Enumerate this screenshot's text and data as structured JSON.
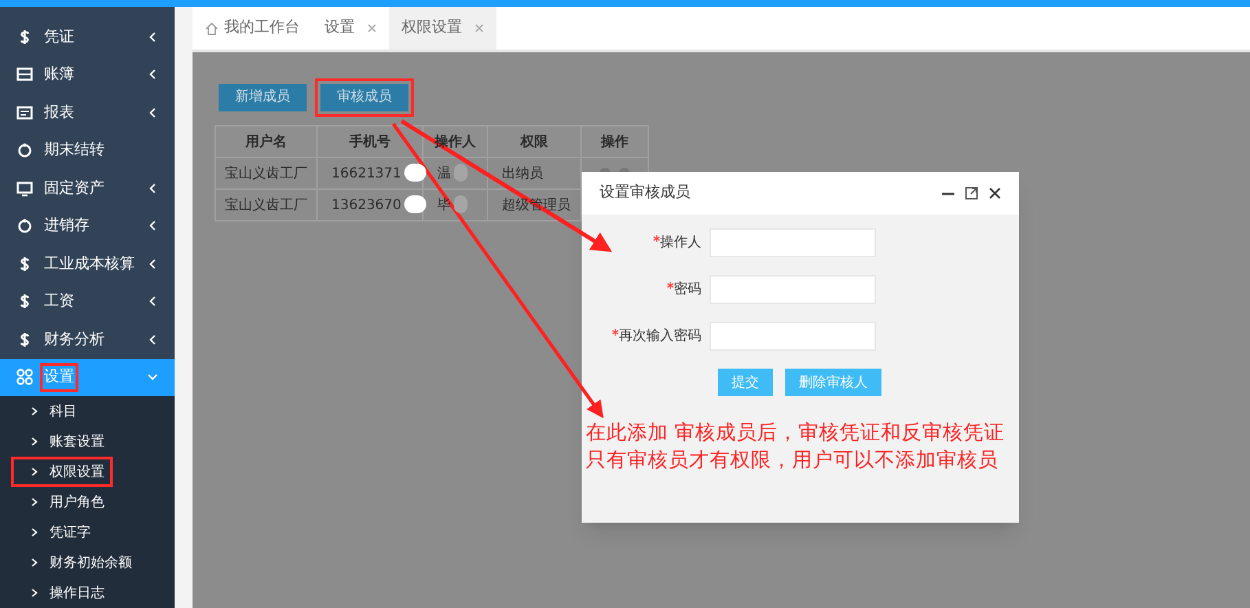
{
  "sidebar": {
    "items": [
      {
        "label": "凭证",
        "kind": "dollar",
        "has_arrow": true,
        "selected": false,
        "expanded": false,
        "highlighted": false
      },
      {
        "label": "账簿",
        "kind": "book",
        "has_arrow": true,
        "selected": false,
        "expanded": false,
        "highlighted": false
      },
      {
        "label": "报表",
        "kind": "report",
        "has_arrow": true,
        "selected": false,
        "expanded": false,
        "highlighted": false
      },
      {
        "label": "期末结转",
        "kind": "cycle",
        "has_arrow": false,
        "selected": false,
        "expanded": false,
        "highlighted": false
      },
      {
        "label": "固定资产",
        "kind": "monitor",
        "has_arrow": true,
        "selected": false,
        "expanded": false,
        "highlighted": false
      },
      {
        "label": "进销存",
        "kind": "cycle",
        "has_arrow": true,
        "selected": false,
        "expanded": false,
        "highlighted": false
      },
      {
        "label": "工业成本核算",
        "kind": "dollar",
        "has_arrow": true,
        "selected": false,
        "expanded": false,
        "highlighted": false
      },
      {
        "label": "工资",
        "kind": "dollar",
        "has_arrow": true,
        "selected": false,
        "expanded": false,
        "highlighted": false
      },
      {
        "label": "财务分析",
        "kind": "dollar",
        "has_arrow": true,
        "selected": false,
        "expanded": false,
        "highlighted": false
      },
      {
        "label": "设置",
        "kind": "grid",
        "has_arrow": true,
        "selected": true,
        "expanded": true,
        "highlighted": true,
        "children": [
          {
            "label": "科目",
            "highlighted": false
          },
          {
            "label": "账套设置",
            "highlighted": false
          },
          {
            "label": "权限设置",
            "highlighted": true
          },
          {
            "label": "用户角色",
            "highlighted": false
          },
          {
            "label": "凭证字",
            "highlighted": false
          },
          {
            "label": "财务初始余额",
            "highlighted": false
          },
          {
            "label": "操作日志",
            "highlighted": false
          }
        ]
      }
    ]
  },
  "tabs": [
    {
      "label": "我的工作台",
      "home": true,
      "closable": false,
      "selected": false
    },
    {
      "label": "设置",
      "home": false,
      "closable": true,
      "selected": false
    },
    {
      "label": "权限设置",
      "home": false,
      "closable": true,
      "selected": true
    }
  ],
  "toolbar": [
    {
      "label": "新增成员",
      "highlighted": false
    },
    {
      "label": "审核成员",
      "highlighted": true
    }
  ],
  "table": {
    "columns": [
      "用户名",
      "手机号",
      "操作人",
      "权限",
      "操作"
    ],
    "rows": [
      [
        "宝山义齿工厂",
        "16621371",
        "温",
        "出纳员"
      ],
      [
        "宝山义齿工厂",
        "13623670",
        "毕",
        "超级管理员"
      ]
    ]
  },
  "dialog": {
    "title": "设置审核成员",
    "fields": [
      {
        "label": "操作人",
        "required": true
      },
      {
        "label": "密码",
        "required": true
      },
      {
        "label": "再次输入密码",
        "required": true
      }
    ],
    "buttons": [
      "提交",
      "删除审核人"
    ],
    "note": "在此添加 审核成员后，审核凭证和反审核凭证只有审核员才有权限，用户可以不添加审核员"
  }
}
